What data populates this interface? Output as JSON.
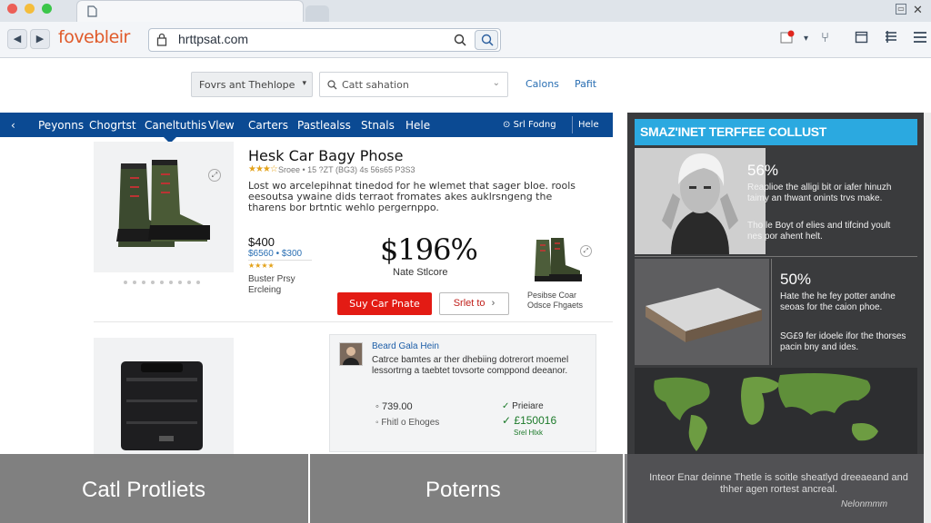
{
  "browser": {
    "url": "hrttpsat.com",
    "brand": "fovebleir"
  },
  "header": {
    "category_select": "Fovrs ant Thehlope",
    "search_placeholder": "Catt sahation",
    "links": [
      "Calons",
      "Pafit"
    ]
  },
  "nav": {
    "items": [
      "Peyonns",
      "Chogrtst",
      "Caneltuthis",
      "Vlew",
      "Carters",
      "Pastlealss",
      "Stnals",
      "Hele"
    ],
    "right_text": "Srl Fodng",
    "right_link": "Hele"
  },
  "product1": {
    "title": "Hesk Car Bagy Phose",
    "stars": "★★★☆",
    "meta": "Sroee • 15 ?ZT (BG3) 4s 56s65 P3S3",
    "description": "Lost wo arcelepihnat tinedod for he wlemet that sager bloe. rools eesoutsa ywaine dids terraot fromates akes auklrsngeng the tharens bor brtntic wehlo pergernppo.",
    "price": "$400",
    "price_sub": "$6560 • $300",
    "rating_small": "★★★★",
    "seller": "Buster Prsy Ercleing",
    "big_price": "$196%",
    "big_price_sub": "Nate Stlcore",
    "buy_label": "Suy Car Pnate",
    "other_label": "Srlet to",
    "thumb_label": "Pesibse Coar Odsce Fhgaets"
  },
  "product2": {
    "name": "Beard Gala Hein",
    "description": "Catrce bamtes ar ther dhebiing dotrerort moemel lessortrng a taebtet tovsorte comppond deeanor.",
    "price": "739.00",
    "price_sub": "Fhitl o Ehoges",
    "check1": "Prieiare",
    "check2": "£150016",
    "check3": "Srel Hlxk"
  },
  "panel": {
    "title": "SMAZ'INET TERFFEE COLLUST",
    "stat1": "56%",
    "stat1_text": "Reaplioe the alligi bit or iafer hinuzh taimy an thwant onints trvs make.",
    "stat1_text2": "Tho le Boyt of elies and tifcind yoult nes por ahent helt.",
    "stat2": "50%",
    "stat2_text": "Hate the he fey potter andne seoas for the caion phoe.",
    "stat2_text2": "SG£9 fer idoele ifor the thorses pacin bny and ides."
  },
  "overlay": {
    "left_label": "Catl Protliets",
    "mid_label": "Poterns",
    "note": "Inteor Enar deinne Thetle is soitle sheatlyd dreeaeand and thher agen rortest ancreal.",
    "tag": "Nelonmmm"
  },
  "colors": {
    "nav": "#0b4a93",
    "buy": "#e31b14",
    "panel_header": "#2ba9e0",
    "link": "#2a6fb3"
  }
}
